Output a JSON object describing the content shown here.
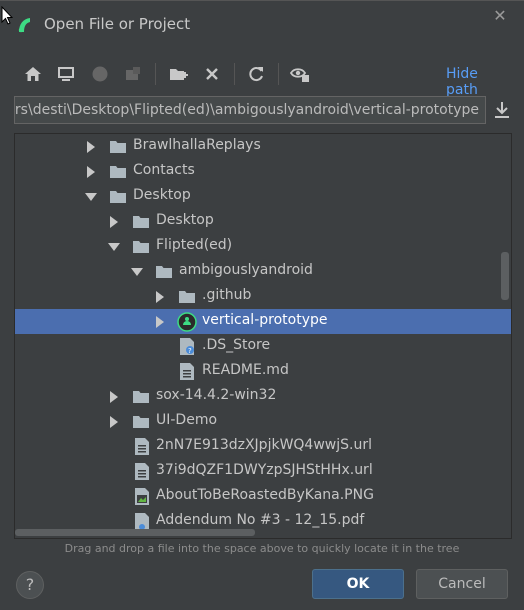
{
  "window": {
    "title": "Open File or Project",
    "close_icon": "close-icon"
  },
  "toolbar": {
    "buttons": [
      "home-icon",
      "desktop-icon",
      "project-icon",
      "module-icon",
      "new-folder-icon",
      "delete-icon",
      "refresh-icon",
      "show-hidden-icon"
    ],
    "hide_path_label": "Hide path"
  },
  "path": {
    "value": "C:\\Users\\desti\\Desktop\\Flipted(ed)\\ambigouslyandroid\\vertical-prototype"
  },
  "tree": {
    "rows": [
      {
        "label": "BrawlhallaReplays",
        "type": "folder"
      },
      {
        "label": "Contacts",
        "type": "folder"
      },
      {
        "label": "Desktop",
        "type": "folder"
      },
      {
        "label": "Desktop",
        "type": "folder"
      },
      {
        "label": "Flipted(ed)",
        "type": "folder"
      },
      {
        "label": "ambigouslyandroid",
        "type": "folder"
      },
      {
        "label": ".github",
        "type": "folder"
      },
      {
        "label": "vertical-prototype",
        "type": "android-project"
      },
      {
        "label": ".DS_Store",
        "type": "unknown-file"
      },
      {
        "label": "README.md",
        "type": "text-file"
      },
      {
        "label": "sox-14.4.2-win32",
        "type": "folder"
      },
      {
        "label": "UI-Demo",
        "type": "folder"
      },
      {
        "label": "2nN7E913dzXJpjkWQ4wwjS.url",
        "type": "text-file"
      },
      {
        "label": "37i9dQZF1DWYzpSJHStHHx.url",
        "type": "text-file"
      },
      {
        "label": "AboutToBeRoastedByKana.PNG",
        "type": "image-file"
      },
      {
        "label": "Addendum No #3 - 12_15.pdf",
        "type": "pdf-file"
      }
    ]
  },
  "hint": "Drag and drop a file into the space above to quickly locate it in the tree",
  "footer": {
    "help_label": "?",
    "ok_label": "OK",
    "cancel_label": "Cancel"
  },
  "colors": {
    "background": "#3c3f41",
    "selection": "#4b6eaf",
    "link": "#589df6",
    "primary_button": "#365880",
    "android_green": "#3ddc84"
  }
}
